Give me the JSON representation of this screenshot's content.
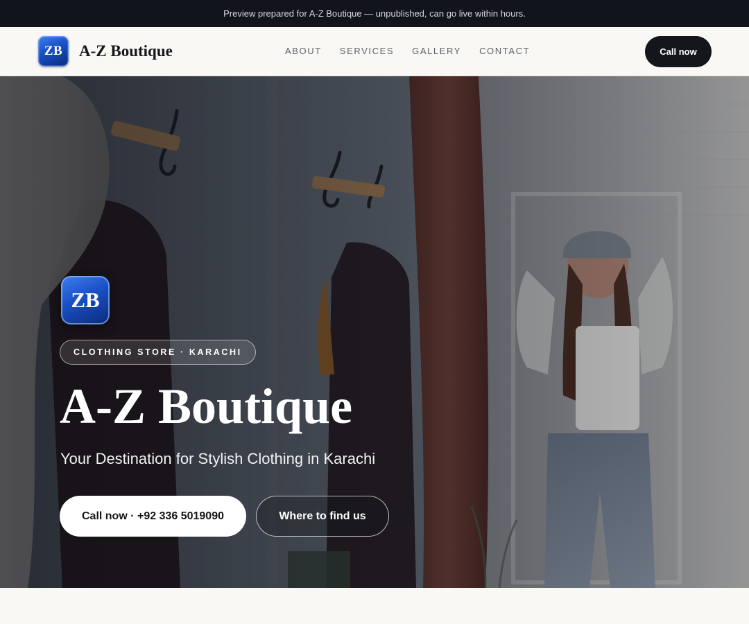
{
  "banner": {
    "text": "Preview prepared for A-Z Boutique — unpublished, can go live within hours."
  },
  "nav": {
    "logo_text": "ZB",
    "brand_name": "A-Z Boutique",
    "links": [
      "ABOUT",
      "SERVICES",
      "GALLERY",
      "CONTACT"
    ],
    "cta_label": "Call now"
  },
  "hero": {
    "logo_text": "ZB",
    "eyebrow": "CLOTHING STORE · KARACHI",
    "title": "A-Z Boutique",
    "subtitle": "Your Destination for Stylish Clothing in Karachi",
    "primary_cta": "Call now · +92 336 5019090",
    "secondary_cta": "Where to find us",
    "image_subject": "woman-in-fitting-room-photo"
  },
  "colors": {
    "dark": "#14161b",
    "banner_bg": "#11141a",
    "page_bg": "#f9f8f5",
    "logo_blue": "#1a4fc4"
  }
}
